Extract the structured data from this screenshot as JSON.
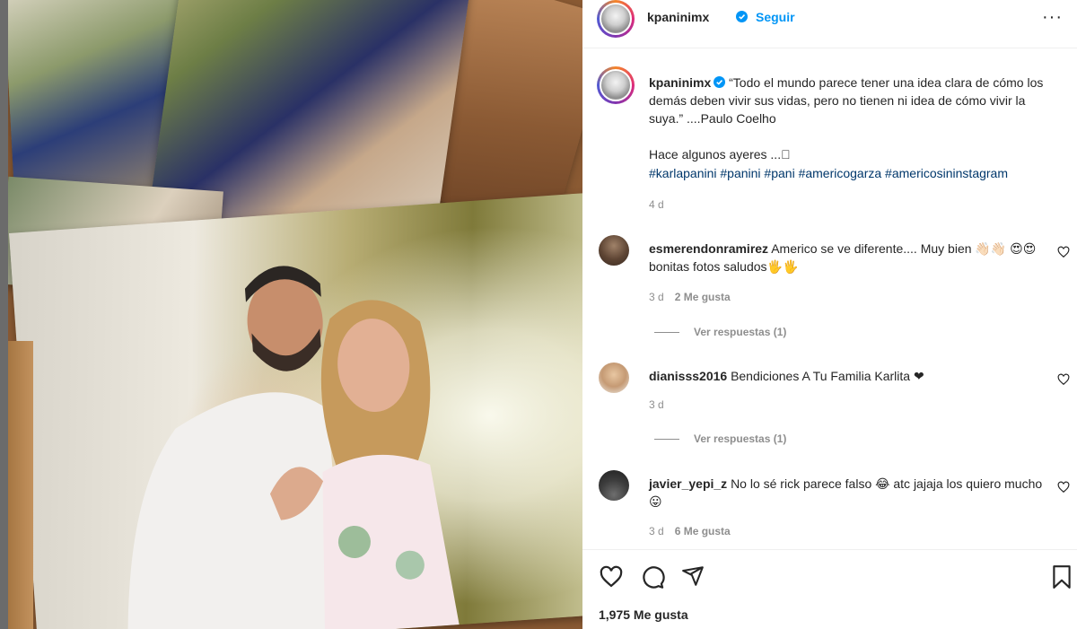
{
  "post": {
    "username": "kpaninimx",
    "follow_label": "Seguir",
    "more_label": "···"
  },
  "caption": {
    "username": "kpaninimx",
    "text": "“Todo el mundo parece tener una idea clara de cómo los demás deben vivir sus vidas, pero no tienen ni idea de cómo vivir la suya.” ....Paulo Coelho",
    "line2": "Hace algunos ayeres ...⃣",
    "hashtags": "#karlapanini #panini #pani #americogarza #americosininstagram",
    "time": "4 d"
  },
  "comments": [
    {
      "username": "esmerendonramirez",
      "text": "Americo se ve diferente.... Muy bien 👋🏻👋🏻 😍😍bonitas fotos saludos🖐🖐",
      "time": "3 d",
      "likes": "2 Me gusta",
      "replies": "Ver respuestas (1)"
    },
    {
      "username": "dianisss2016",
      "text": "Bendiciones A Tu Familia Karlita ❤",
      "time": "3 d",
      "likes": "",
      "replies": "Ver respuestas (1)"
    },
    {
      "username": "javier_yepi_z",
      "text": "No lo sé rick parece falso 😂 atc jajaja los quiero mucho 😛",
      "time": "3 d",
      "likes": "6 Me gusta",
      "replies": ""
    }
  ],
  "footer": {
    "likes": "1,975 Me gusta"
  },
  "icons": {
    "like": "heart-icon",
    "comment": "comment-icon",
    "share": "share-icon",
    "save": "bookmark-icon",
    "verified": "verified-badge-icon"
  },
  "colors": {
    "link": "#0095f6",
    "hashtag": "#00376b",
    "muted": "#8e8e8e",
    "verified": "#0095f6"
  }
}
